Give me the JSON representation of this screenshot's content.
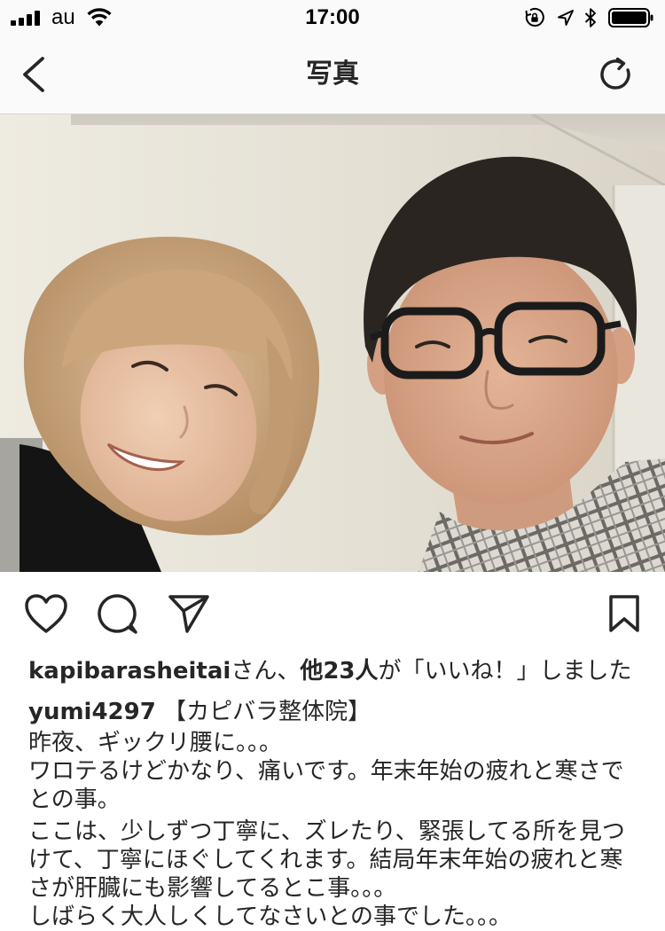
{
  "status_bar": {
    "carrier": "au",
    "time": "17:00",
    "signal_bars": 4,
    "signal_bars_max": 4,
    "battery_level": 1.0,
    "icons": [
      "signal-icon",
      "wifi-icon",
      "rotation-lock-icon",
      "location-icon",
      "bluetooth-icon",
      "battery-icon"
    ]
  },
  "nav": {
    "title": "写真",
    "back_icon": "chevron-left-icon",
    "refresh_icon": "refresh-icon"
  },
  "post": {
    "actions": {
      "like_icon": "heart-outline-icon",
      "comment_icon": "comment-icon",
      "share_icon": "send-icon",
      "save_icon": "bookmark-outline-icon"
    },
    "likes": {
      "liked_by": "kapibarasheitai",
      "liked_by_suffix": "さん、",
      "others": "他23人",
      "suffix": "が「いいね！」しました"
    },
    "caption": {
      "username": "yumi4297",
      "heading": "【カピバラ整体院】",
      "lines": [
        "昨夜、ギックリ腰に。。。",
        "ワロテるけどかなり、痛いです。年末年始の疲れと寒さで",
        "との事。",
        "ここは、少しずつ丁寧に、ズレたり、緊張してる所を見つ",
        "けて、丁寧にほぐしてくれます。結局年末年始の疲れと寒",
        "さが肝臓にも影響してるとこ事。。。",
        "しばらく大人しくしてなさいとの事でした。。。"
      ]
    }
  },
  "colors": {
    "text": "#262626",
    "bar_background": "#fafafa",
    "divider": "#d6d6d6",
    "page_background": "#ffffff"
  }
}
